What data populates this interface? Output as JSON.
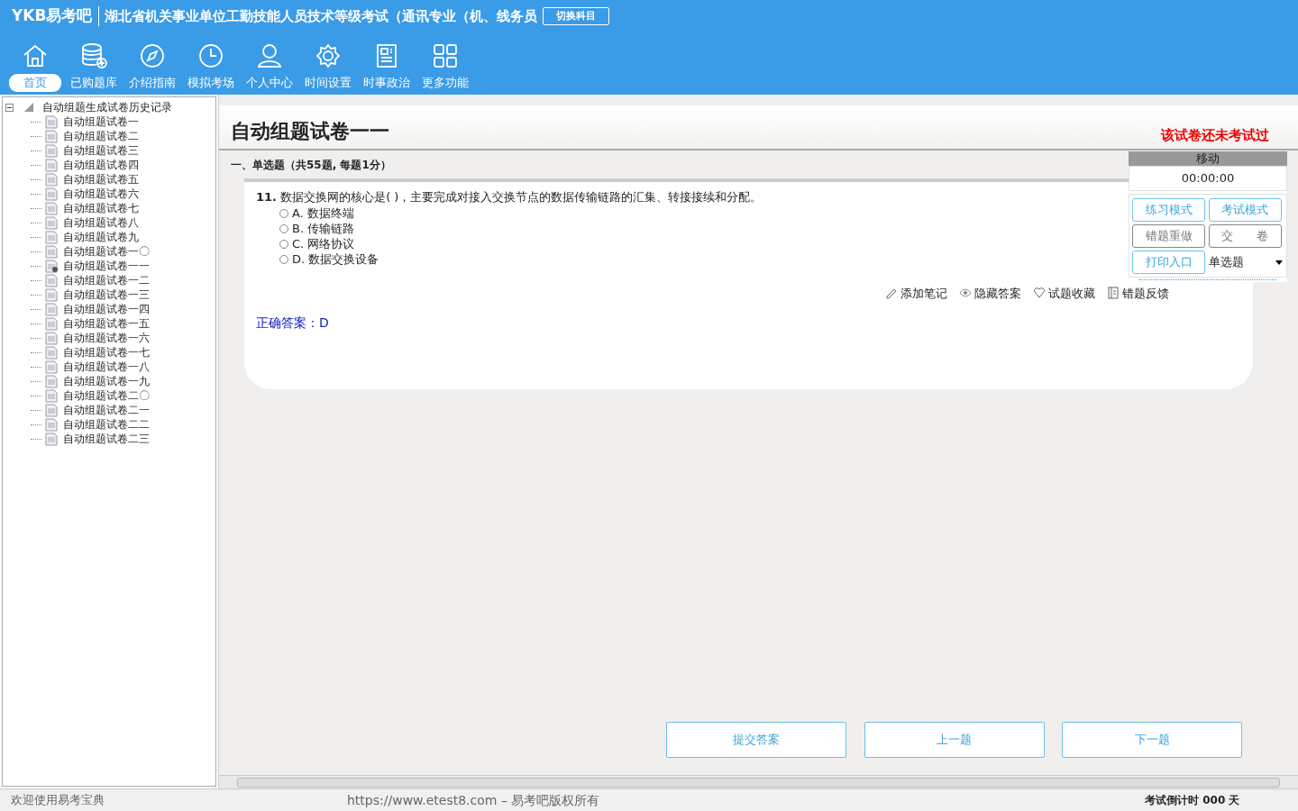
{
  "header": {
    "logo": "YKB易考吧",
    "title": "湖北省机关事业单位工勤技能人员技术等级考试（通讯专业（机、线务员",
    "switch_button": "切换科目"
  },
  "toolbar": [
    {
      "label": "首页",
      "selected": true
    },
    {
      "label": "已购题库",
      "selected": false
    },
    {
      "label": "介绍指南",
      "selected": false
    },
    {
      "label": "模拟考场",
      "selected": false
    },
    {
      "label": "个人中心",
      "selected": false
    },
    {
      "label": "时间设置",
      "selected": false
    },
    {
      "label": "时事政治",
      "selected": false
    },
    {
      "label": "更多功能",
      "selected": false
    }
  ],
  "tree": {
    "label": "自动组题生成试卷历史记录",
    "expanded": true,
    "children": [
      {
        "label": "自动组题试卷一",
        "selected": false
      },
      {
        "label": "自动组题试卷二",
        "selected": false
      },
      {
        "label": "自动组题试卷三",
        "selected": false
      },
      {
        "label": "自动组题试卷四",
        "selected": false
      },
      {
        "label": "自动组题试卷五",
        "selected": false
      },
      {
        "label": "自动组题试卷六",
        "selected": false
      },
      {
        "label": "自动组题试卷七",
        "selected": false
      },
      {
        "label": "自动组题试卷八",
        "selected": false
      },
      {
        "label": "自动组题试卷九",
        "selected": false
      },
      {
        "label": "自动组题试卷一〇",
        "selected": false
      },
      {
        "label": "自动组题试卷一一",
        "selected": true
      },
      {
        "label": "自动组题试卷一二",
        "selected": false
      },
      {
        "label": "自动组题试卷一三",
        "selected": false
      },
      {
        "label": "自动组题试卷一四",
        "selected": false
      },
      {
        "label": "自动组题试卷一五",
        "selected": false
      },
      {
        "label": "自动组题试卷一六",
        "selected": false
      },
      {
        "label": "自动组题试卷一七",
        "selected": false
      },
      {
        "label": "自动组题试卷一八",
        "selected": false
      },
      {
        "label": "自动组题试卷一九",
        "selected": false
      },
      {
        "label": "自动组题试卷二〇",
        "selected": false
      },
      {
        "label": "自动组题试卷二一",
        "selected": false
      },
      {
        "label": "自动组题试卷二二",
        "selected": false
      },
      {
        "label": "自动组题试卷二三",
        "selected": false
      }
    ]
  },
  "paper": {
    "title": "自动组题试卷一一",
    "status": "该试卷还未考试过",
    "section": "一、单选题（共55题, 每题1分）"
  },
  "question": {
    "number": "11.",
    "text": "数据交换网的核心是( )，主要完成对接入交换节点的数据传输链路的汇集、转接接续和分配。",
    "options": [
      {
        "label": "A. 数据终端",
        "selected": false
      },
      {
        "label": "B. 传输链路",
        "selected": false
      },
      {
        "label": "C. 网络协议",
        "selected": false
      },
      {
        "label": "D. 数据交换设备",
        "selected": false
      }
    ],
    "actions": [
      "添加笔记",
      "隐藏答案",
      "试题收藏",
      "错题反馈"
    ],
    "answer": "正确答案：D"
  },
  "float_panel": {
    "title": "移动",
    "timer": "00:00:00",
    "buttons": [
      {
        "label": "练习模式",
        "kind": "accent"
      },
      {
        "label": "考试模式",
        "kind": "accent"
      },
      {
        "label": "错题重做",
        "kind": "plain"
      },
      {
        "label": "交　　卷",
        "kind": "plain"
      },
      {
        "label": "打印入口",
        "kind": "accent"
      }
    ],
    "type_select": "单选题"
  },
  "nav_buttons": [
    "提交答案",
    "上一题",
    "下一题"
  ],
  "status_bar": {
    "welcome": "欢迎使用易考宝典",
    "copyright": "https://www.etest8.com – 易考吧版权所有",
    "countdown": "考试倒计时 000 天"
  }
}
